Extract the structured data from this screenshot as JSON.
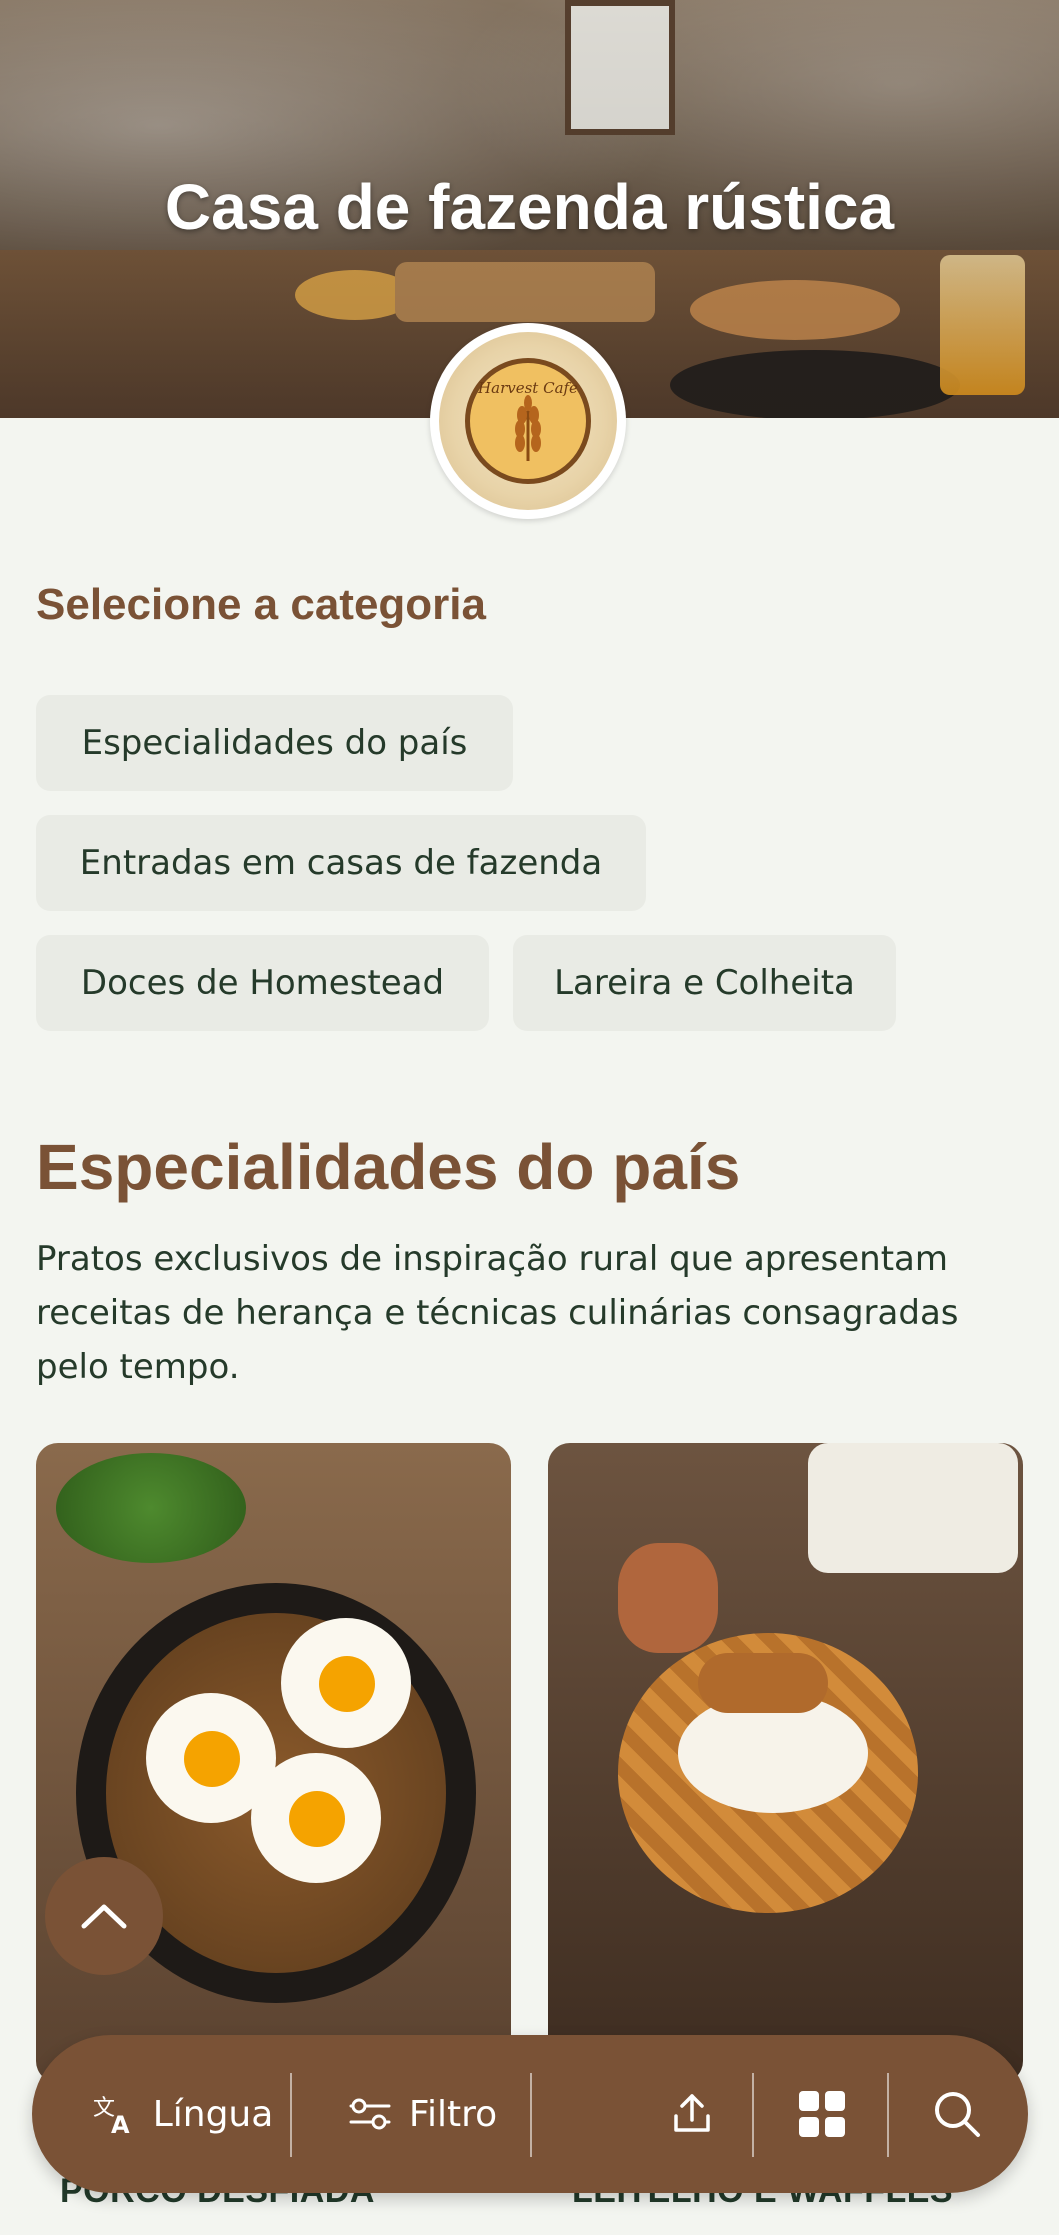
{
  "hero": {
    "title": "Casa de fazenda rústica"
  },
  "logo": {
    "text": "Harvest Cafe"
  },
  "category": {
    "label": "Selecione a categoria",
    "chips": [
      "Especialidades do país",
      "Entradas em casas de fazenda",
      "Doces de Homestead",
      "Lareira e Colheita"
    ]
  },
  "section": {
    "title": "Especialidades do país",
    "description": "Pratos exclusivos de inspiração rural que apresentam receitas de herança e técnicas culinárias consagradas pelo tempo."
  },
  "cards": [
    {
      "title": "PORCO DESFIADA"
    },
    {
      "title": "LEITELHO E WAFFLES"
    }
  ],
  "bottom_bar": {
    "language_label": "Língua",
    "filter_label": "Filtro"
  },
  "colors": {
    "accent": "#7a5236",
    "background": "#f3f5f0",
    "chip": "#e9ebe5"
  },
  "icons": [
    "translate-icon",
    "filter-icon",
    "share-icon",
    "grid-icon",
    "search-icon",
    "chevron-up-icon"
  ]
}
